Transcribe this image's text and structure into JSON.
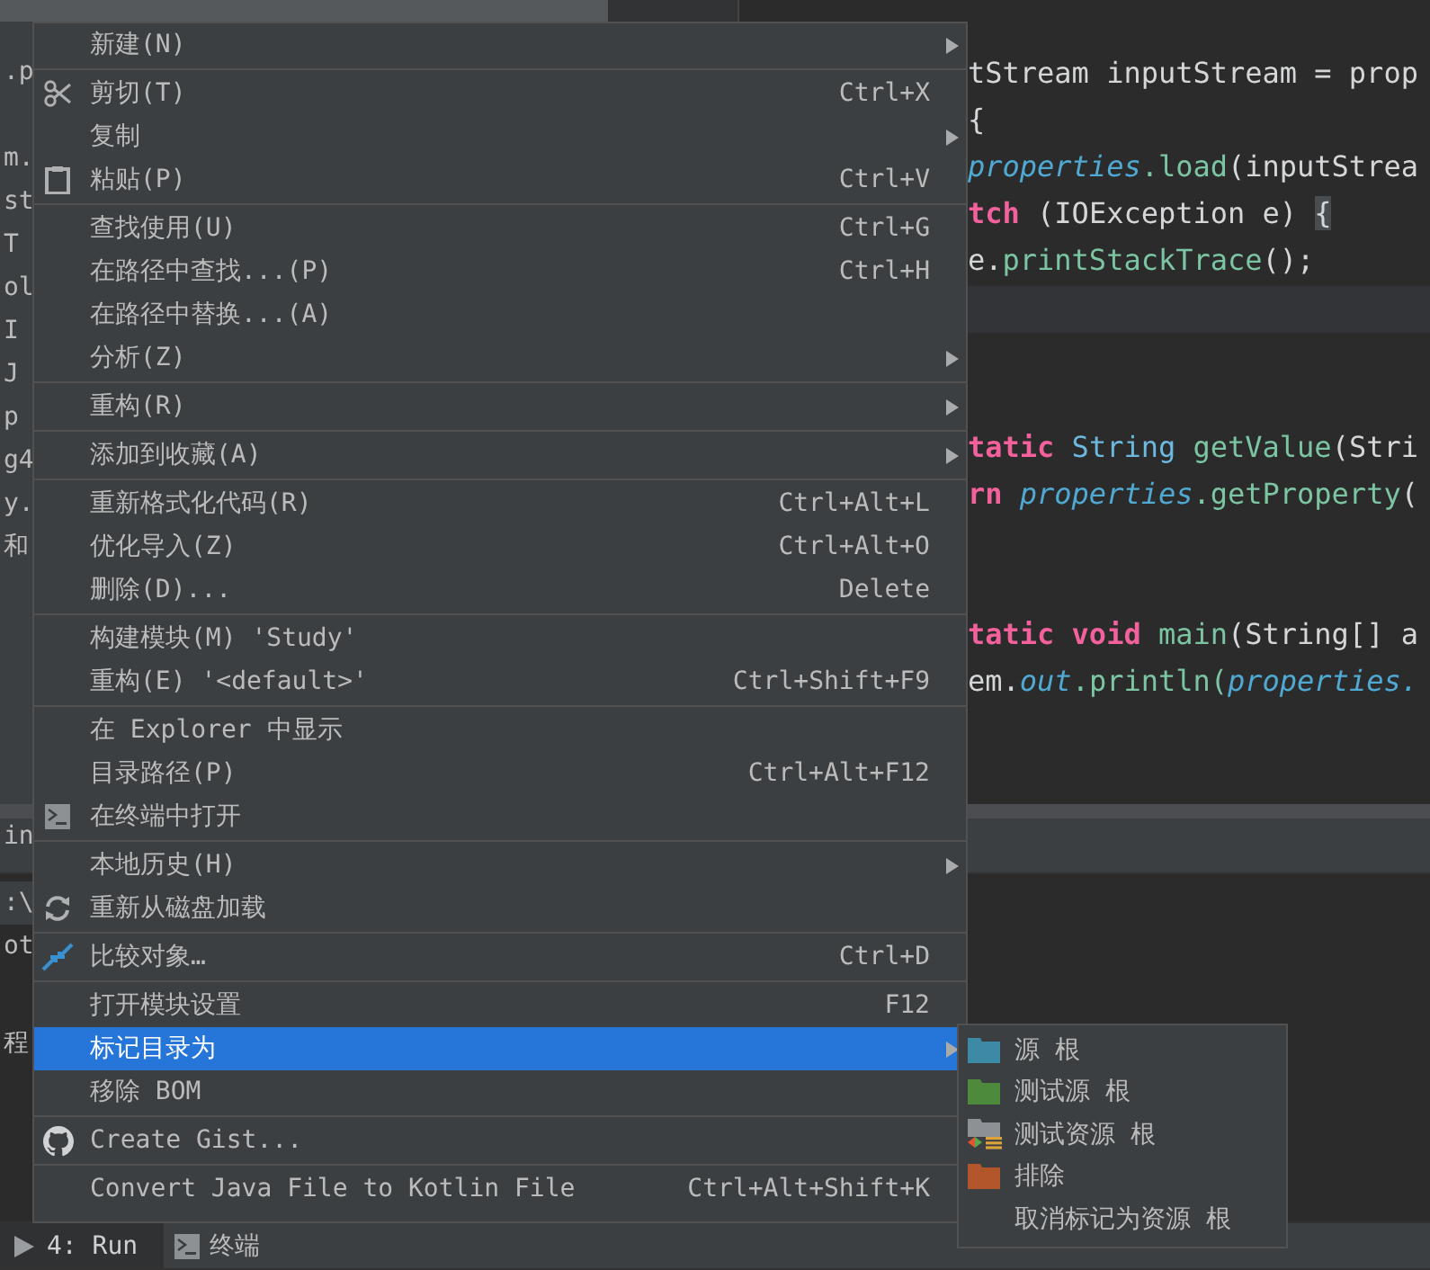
{
  "project_tree": {
    "blocks": [
      [
        ".p"
      ],
      [
        "m.",
        "st",
        "T",
        "ol",
        "I",
        "J",
        "p",
        "g4",
        "y.",
        "和"
      ]
    ]
  },
  "editor": {
    "blocks": [
      [
        {
          "tokens": [
            {
              "text": "tStream inputStream = ",
              "kind": "plain"
            },
            {
              "text": "prop",
              "kind": "plain"
            }
          ]
        },
        {
          "tokens": [
            {
              "text": "{",
              "kind": "plain"
            }
          ]
        },
        {
          "tokens": [
            {
              "text": "properties",
              "kind": "field"
            },
            {
              "text": ".load",
              "kind": "method"
            },
            {
              "text": "(inputStrea",
              "kind": "plain"
            }
          ]
        },
        {
          "tokens": [
            {
              "text": "tch",
              "kind": "keyword"
            },
            {
              "text": " (IOException e) ",
              "kind": "plain"
            },
            {
              "text": "{",
              "kind": "brace_match"
            }
          ]
        },
        {
          "tokens": [
            {
              "text": "e.",
              "kind": "plain"
            },
            {
              "text": "printStackTrace",
              "kind": "method"
            },
            {
              "text": "();",
              "kind": "plain"
            }
          ]
        }
      ],
      [
        {
          "tokens": [
            {
              "text": "tatic",
              "kind": "keyword"
            },
            {
              "text": " String",
              "kind": "type"
            },
            {
              "text": " getValue",
              "kind": "method"
            },
            {
              "text": "(Stri",
              "kind": "plain"
            }
          ]
        },
        {
          "tokens": [
            {
              "text": "rn",
              "kind": "keyword"
            },
            {
              "text": " properties",
              "kind": "field"
            },
            {
              "text": ".getProperty",
              "kind": "method"
            },
            {
              "text": "(",
              "kind": "plain"
            }
          ]
        }
      ],
      [
        {
          "tokens": [
            {
              "text": "tatic void",
              "kind": "keyword"
            },
            {
              "text": " main",
              "kind": "method"
            },
            {
              "text": "(String[] a",
              "kind": "plain"
            }
          ]
        },
        {
          "tokens": [
            {
              "text": "em.",
              "kind": "plain"
            },
            {
              "text": "out",
              "kind": "field"
            },
            {
              "text": ".println(",
              "kind": "method"
            },
            {
              "text": "properties.",
              "kind": "field"
            }
          ]
        }
      ]
    ]
  },
  "tool_window": {
    "fragments": [
      "in",
      ":\\",
      "ot",
      "程"
    ]
  },
  "bottom_tabs": [
    {
      "label": "4: Run",
      "kind": "run",
      "selected": true
    },
    {
      "label": "终端",
      "kind": "terminal",
      "selected": false
    }
  ],
  "context_menu": {
    "groups": [
      {
        "items": [
          {
            "label": "新建(N)",
            "kind": "plain",
            "has_submenu": true,
            "selected": false
          }
        ]
      },
      {
        "items": [
          {
            "label": "剪切(T)",
            "kind": "cut",
            "shortcut": "Ctrl+X",
            "has_submenu": false,
            "selected": false
          },
          {
            "label": "复制",
            "kind": "plain",
            "has_submenu": true,
            "selected": false
          },
          {
            "label": "粘贴(P)",
            "kind": "paste",
            "shortcut": "Ctrl+V",
            "has_submenu": false,
            "selected": false
          }
        ]
      },
      {
        "items": [
          {
            "label": "查找使用(U)",
            "kind": "plain",
            "shortcut": "Ctrl+G",
            "has_submenu": false,
            "selected": false
          },
          {
            "label": "在路径中查找...(P)",
            "kind": "plain",
            "shortcut": "Ctrl+H",
            "has_submenu": false,
            "selected": false
          },
          {
            "label": "在路径中替换...(A)",
            "kind": "plain",
            "has_submenu": false,
            "selected": false
          },
          {
            "label": "分析(Z)",
            "kind": "plain",
            "has_submenu": true,
            "selected": false
          }
        ]
      },
      {
        "items": [
          {
            "label": "重构(R)",
            "kind": "plain",
            "has_submenu": true,
            "selected": false
          }
        ]
      },
      {
        "items": [
          {
            "label": "添加到收藏(A)",
            "kind": "plain",
            "has_submenu": true,
            "selected": false
          }
        ]
      },
      {
        "items": [
          {
            "label": "重新格式化代码(R)",
            "kind": "plain",
            "shortcut": "Ctrl+Alt+L",
            "has_submenu": false,
            "selected": false
          },
          {
            "label": "优化导入(Z)",
            "kind": "plain",
            "shortcut": "Ctrl+Alt+O",
            "has_submenu": false,
            "selected": false
          },
          {
            "label": "删除(D)...",
            "kind": "plain",
            "shortcut": "Delete",
            "has_submenu": false,
            "selected": false
          }
        ]
      },
      {
        "items": [
          {
            "label": "构建模块(M) 'Study'",
            "kind": "plain",
            "has_submenu": false,
            "selected": false
          },
          {
            "label": "重构(E) '<default>'",
            "kind": "plain",
            "shortcut": "Ctrl+Shift+F9",
            "has_submenu": false,
            "selected": false
          }
        ]
      },
      {
        "items": [
          {
            "label": "在 Explorer 中显示",
            "kind": "plain",
            "has_submenu": false,
            "selected": false
          },
          {
            "label": "目录路径(P)",
            "kind": "plain",
            "shortcut": "Ctrl+Alt+F12",
            "has_submenu": false,
            "selected": false
          },
          {
            "label": "在终端中打开",
            "kind": "terminal",
            "has_submenu": false,
            "selected": false
          }
        ]
      },
      {
        "items": [
          {
            "label": "本地历史(H)",
            "kind": "plain",
            "has_submenu": true,
            "selected": false
          },
          {
            "label": "重新从磁盘加载",
            "kind": "reload",
            "has_submenu": false,
            "selected": false
          }
        ]
      },
      {
        "items": [
          {
            "label": "比较对象…",
            "kind": "compare",
            "shortcut": "Ctrl+D",
            "has_submenu": false,
            "selected": false
          }
        ]
      },
      {
        "items": [
          {
            "label": "打开模块设置",
            "kind": "plain",
            "shortcut": "F12",
            "has_submenu": false,
            "selected": false
          },
          {
            "label": "标记目录为",
            "kind": "plain",
            "has_submenu": true,
            "selected": true
          },
          {
            "label": "移除 BOM",
            "kind": "plain",
            "has_submenu": false,
            "selected": false
          }
        ]
      },
      {
        "items": [
          {
            "label": "Create Gist...",
            "kind": "gist",
            "has_submenu": false,
            "selected": false
          }
        ]
      },
      {
        "items": [
          {
            "label": "Convert Java File to Kotlin File",
            "kind": "plain",
            "shortcut": "Ctrl+Alt+Shift+K",
            "has_submenu": false,
            "selected": false
          }
        ]
      }
    ]
  },
  "submenu": {
    "items": [
      {
        "label": "源 根",
        "kind": "sources"
      },
      {
        "label": "测试源 根",
        "kind": "tests"
      },
      {
        "label": "测试资源 根",
        "kind": "test_resources"
      },
      {
        "label": "排除",
        "kind": "excluded"
      },
      {
        "label": "取消标记为资源 根",
        "kind": "plain"
      }
    ]
  }
}
